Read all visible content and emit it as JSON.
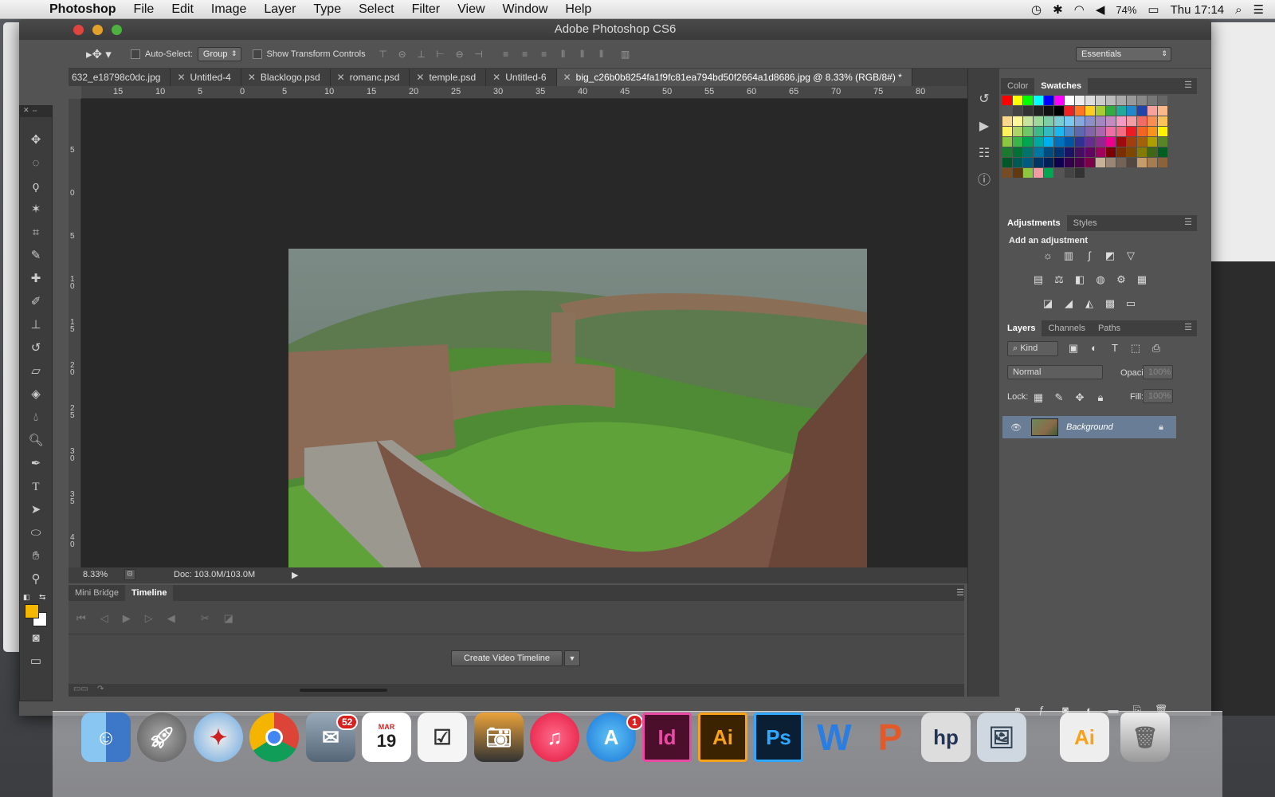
{
  "menubar": {
    "app_name": "Photoshop",
    "items": [
      "File",
      "Edit",
      "Image",
      "Layer",
      "Type",
      "Select",
      "Filter",
      "View",
      "Window",
      "Help"
    ],
    "battery": "74%",
    "clock": "Thu 17:14"
  },
  "window": {
    "title": "Adobe Photoshop CS6"
  },
  "options": {
    "auto_select_label": "Auto-Select:",
    "auto_select_value": "Group",
    "show_transform_label": "Show Transform Controls",
    "workspace": "Essentials"
  },
  "tabs": [
    {
      "label": "632_e18798c0dc.jpg"
    },
    {
      "label": "Untitled-4"
    },
    {
      "label": "Blacklogo.psd"
    },
    {
      "label": "romanc.psd"
    },
    {
      "label": "temple.psd"
    },
    {
      "label": "Untitled-6"
    },
    {
      "label": "big_c26b0b8254fa1f9fc81ea794bd50f2664a1d8686.jpg @ 8.33% (RGB/8#) *"
    }
  ],
  "ruler_h": [
    "15",
    "10",
    "5",
    "0",
    "5",
    "10",
    "15",
    "20",
    "25",
    "30",
    "35",
    "40",
    "45",
    "50",
    "55",
    "60",
    "65",
    "70",
    "75",
    "80"
  ],
  "ruler_v": [
    "5",
    "0",
    "5",
    "1 0",
    "1 5",
    "2 0",
    "2 5",
    "3 0",
    "3 5",
    "4 0",
    "4"
  ],
  "status": {
    "zoom": "8.33%",
    "doc": "Doc: 103.0M/103.0M"
  },
  "bottom_panel": {
    "tabs": [
      "Mini Bridge",
      "Timeline"
    ],
    "create_button": "Create Video Timeline"
  },
  "color_panel": {
    "tabs": [
      "Color",
      "Swatches"
    ]
  },
  "adjustments": {
    "tabs": [
      "Adjustments",
      "Styles"
    ],
    "heading": "Add an adjustment"
  },
  "layers": {
    "tabs": [
      "Layers",
      "Channels",
      "Paths"
    ],
    "kind": "Kind",
    "blend_mode": "Normal",
    "opacity_label": "Opacity:",
    "opacity_value": "100%",
    "lock_label": "Lock:",
    "fill_label": "Fill:",
    "fill_value": "100%",
    "layer_name": "Background"
  },
  "dock": {
    "mail_badge": "52",
    "appstore_badge": "1",
    "calendar_month": "MAR",
    "calendar_day": "19"
  },
  "colors": {
    "foreground": "#f5b800",
    "background": "#ffffff",
    "layer_selected": "#6a7d96"
  }
}
